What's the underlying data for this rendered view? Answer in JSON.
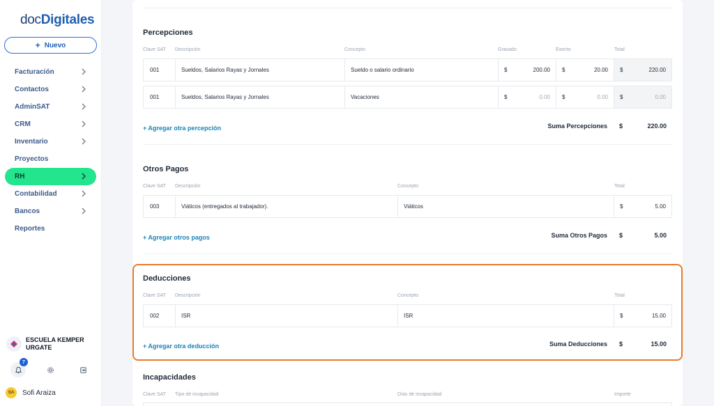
{
  "brand": {
    "prefix": "doc",
    "suffix": "Digitales"
  },
  "new_button": {
    "icon": "plus-icon",
    "label": "Nuevo"
  },
  "sidebar": {
    "items": [
      {
        "label": "Facturación",
        "has_chevron": true,
        "active": false
      },
      {
        "label": "Contactos",
        "has_chevron": true,
        "active": false
      },
      {
        "label": "AdminSAT",
        "has_chevron": true,
        "active": false
      },
      {
        "label": "CRM",
        "has_chevron": true,
        "active": false
      },
      {
        "label": "Inventario",
        "has_chevron": true,
        "active": false
      },
      {
        "label": "Proyectos",
        "has_chevron": false,
        "active": false
      },
      {
        "label": "RH",
        "has_chevron": true,
        "active": true
      },
      {
        "label": "Contabilidad",
        "has_chevron": true,
        "active": false
      },
      {
        "label": "Bancos",
        "has_chevron": true,
        "active": false
      },
      {
        "label": "Reportes",
        "has_chevron": false,
        "active": false
      }
    ],
    "company": "ESCUELA KEMPER URGATE",
    "notifications_count": "7",
    "user": {
      "initials": "SA",
      "name": "Sofi Araiza"
    }
  },
  "percepciones": {
    "title": "Percepciones",
    "headers": {
      "clave": "Clave SAT",
      "descripcion": "Descripción",
      "concepto": "Concepto",
      "gravado": "Gravado",
      "exento": "Exento",
      "total": "Total"
    },
    "rows": [
      {
        "clave": "001",
        "descripcion": "Sueldos, Salarios Rayas y Jornales",
        "concepto": "Sueldo o salario ordinario",
        "gravado_cur": "$",
        "gravado": "200.00",
        "exento_cur": "$",
        "exento": "20.00",
        "total_cur": "$",
        "total": "220.00"
      },
      {
        "clave": "001",
        "descripcion": "Sueldos, Salarios Rayas y Jornales",
        "concepto": "Vacaciones",
        "gravado_cur": "$",
        "gravado": "0.00",
        "exento_cur": "$",
        "exento": "0.00",
        "total_cur": "$",
        "total": "0.00"
      }
    ],
    "add_label": "+ Agregar otra percepción",
    "sum_label": "Suma Percepciones",
    "sum_cur": "$",
    "sum_value": "220.00"
  },
  "otros_pagos": {
    "title": "Otros Pagos",
    "headers": {
      "clave": "Clave SAT",
      "descripcion": "Descripción",
      "concepto": "Concepto",
      "total": "Total"
    },
    "rows": [
      {
        "clave": "003",
        "descripcion": "Viáticos (entregados al trabajador).",
        "concepto": "Viáticos",
        "total_cur": "$",
        "total": "5.00"
      }
    ],
    "add_label": "+ Agregar otros pagos",
    "sum_label": "Suma Otros Pagos",
    "sum_cur": "$",
    "sum_value": "5.00"
  },
  "deducciones": {
    "title": "Deducciones",
    "headers": {
      "clave": "Clave SAT",
      "descripcion": "Descripción",
      "concepto": "Concepto",
      "total": "Total"
    },
    "rows": [
      {
        "clave": "002",
        "descripcion": "ISR",
        "concepto": "ISR",
        "total_cur": "$",
        "total": "15.00"
      }
    ],
    "add_label": "+ Agregar otra deducción",
    "sum_label": "Suma Deducciones",
    "sum_cur": "$",
    "sum_value": "15.00"
  },
  "incapacidades": {
    "title": "Incapacidades",
    "headers": {
      "clave": "Clave SAT",
      "tipo": "Tipo de incapacidad",
      "dias": "Días de incapacidad",
      "importe": "Importe"
    }
  },
  "colors": {
    "accent_green": "#22e58e",
    "brand_blue": "#1f5fb0",
    "link": "#1985b8",
    "highlight": "#ea7a28"
  }
}
